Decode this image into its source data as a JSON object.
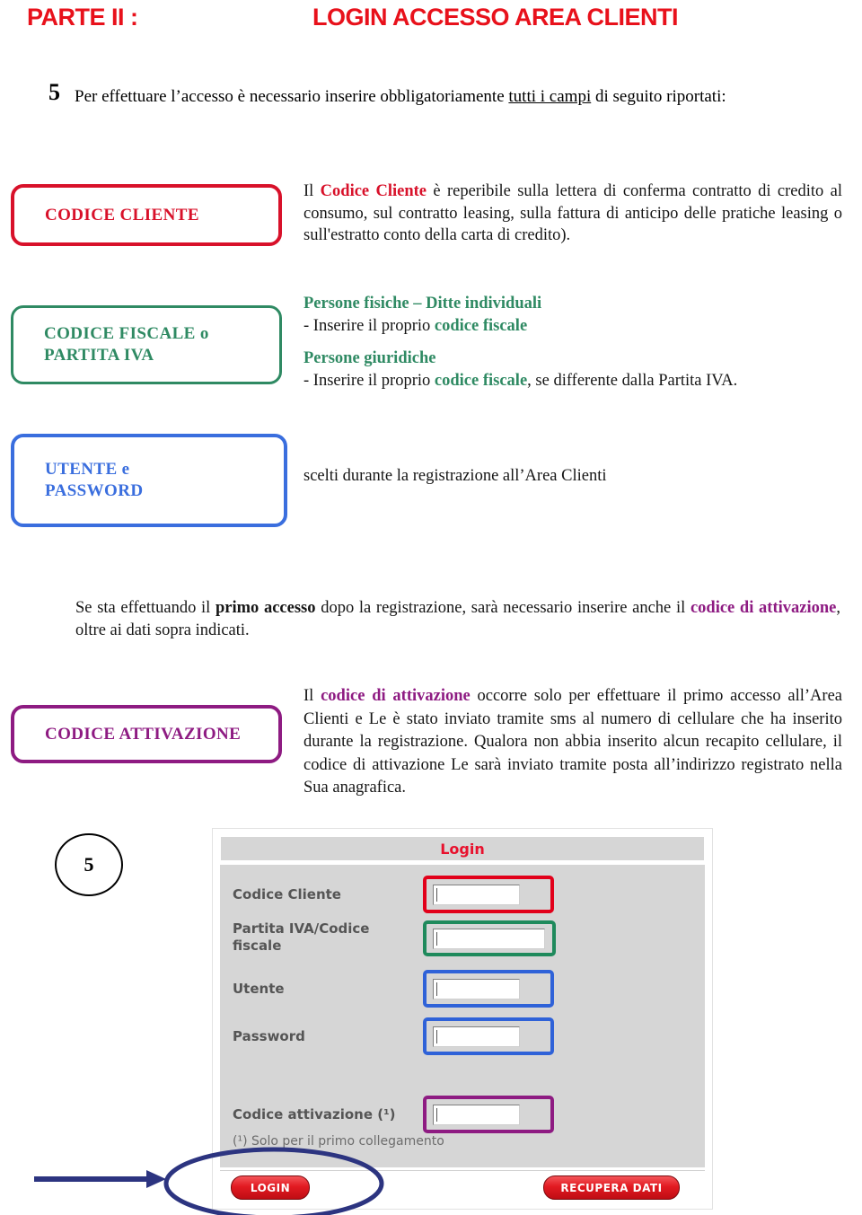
{
  "header": {
    "part_label": "PARTE II :",
    "title": "LOGIN ACCESSO AREA CLIENTI",
    "accent_color": "#e8111b"
  },
  "intro": {
    "number": "5",
    "text_before": "Per effettuare l’accesso è necessario inserire obbligatoriamente ",
    "underlined": "tutti i campi",
    "text_after": " di seguito riportati:"
  },
  "sections": [
    {
      "box_label": "CODICE CLIENTE",
      "box_color": "#d8112a",
      "paragraph_parts": [
        {
          "text": "Il ",
          "style": "normal"
        },
        {
          "text": "Codice Cliente",
          "style": "red-bold"
        },
        {
          "text": " è reperibile sulla lettera di conferma contratto di credito al consumo, sul contratto leasing, sulla fattura di anticipo delle pratiche leasing o sull'estratto conto della carta di credito).",
          "style": "normal"
        }
      ]
    },
    {
      "box_label_line1": "CODICE FISCALE o",
      "box_label_line2": "PARTITA IVA",
      "box_color": "#2f8a63",
      "heading1": "Persone fisiche – Ditte individuali",
      "line1_before": "- Inserire il proprio ",
      "line1_highlight": "codice fiscale",
      "heading2": "Persone giuridiche",
      "line2_before": "- Inserire il proprio ",
      "line2_highlight": "codice fiscale",
      "line2_after": ", se differente dalla Partita IVA."
    },
    {
      "box_label_line1": "UTENTE e",
      "box_label_line2": "PASSWORD",
      "box_color": "#3a6ede",
      "paragraph": "scelti durante la registrazione all’Area Clienti"
    },
    {
      "box_label": "CODICE ATTIVAZIONE",
      "box_color": "#8e1b82",
      "paragraph_parts": [
        {
          "text": "Il ",
          "style": "normal"
        },
        {
          "text": "codice di attivazione",
          "style": "purple-bold"
        },
        {
          "text": " occorre solo per effettuare il primo accesso all’Area Clienti e Le è stato inviato tramite sms al numero di cellulare che ha inserito durante la registrazione. Qualora non abbia inserito alcun recapito cellulare, il codice di attivazione Le sarà inviato tramite posta all’indirizzo registrato nella Sua anagrafica.",
          "style": "normal"
        }
      ]
    }
  ],
  "primo_accesso": {
    "part1": "Se sta effettuando il ",
    "bold1": "primo accesso",
    "part2": " dopo la registrazione, sarà necessario inserire anche il ",
    "purple1": "codice di attivazione",
    "part3": ", oltre ai dati sopra indicati."
  },
  "step_badge": {
    "number": "5"
  },
  "login_screenshot": {
    "title": "Login",
    "title_color": "#e8112d",
    "fields": [
      {
        "label": "Codice Cliente",
        "value": "",
        "highlight_color": "#e2001a",
        "name": "codice-cliente"
      },
      {
        "label": "Partita IVA/Codice fiscale",
        "value": "",
        "highlight_color": "#1f8a5c",
        "name": "partita-iva-codice-fiscale"
      },
      {
        "label": "Utente",
        "value": "",
        "highlight_color": "#2f62d8",
        "name": "utente"
      },
      {
        "label": "Password",
        "value": "",
        "highlight_color": "#2f62d8",
        "name": "password"
      },
      {
        "label": "Codice attivazione (¹)",
        "value": "",
        "highlight_color": "#8e1b82",
        "name": "codice-attivazione"
      }
    ],
    "footnote": "(¹) Solo per il primo collegamento",
    "buttons": [
      {
        "label": "LOGIN",
        "name": "login"
      },
      {
        "label": "RECUPERA DATI",
        "name": "recupera-dati"
      }
    ]
  },
  "annotation": {
    "color": "#2c3480",
    "highlight_target": "LOGIN"
  }
}
